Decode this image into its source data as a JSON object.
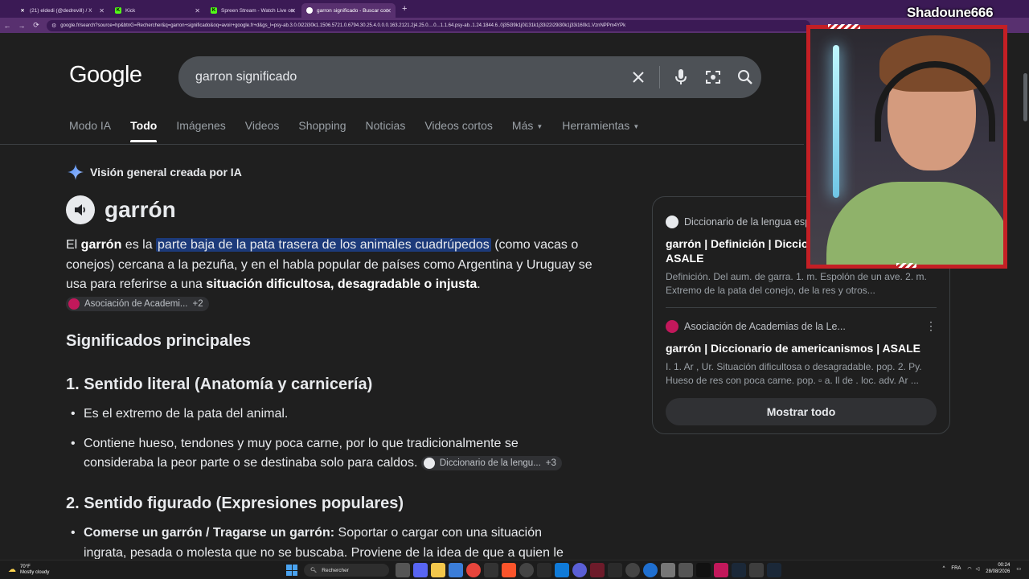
{
  "browser": {
    "tabs": [
      {
        "label": "(21) eldedi (@dedrevill) / X",
        "icon": "x-logo-icon",
        "active": false
      },
      {
        "label": "Kick",
        "icon": "kick-logo-icon",
        "active": false
      },
      {
        "label": "Spreen Stream - Watch Live on",
        "icon": "kick-logo-icon",
        "active": false
      },
      {
        "label": "garron significado - Buscar con",
        "icon": "google-logo-icon",
        "active": true
      }
    ],
    "new_tab": "+",
    "url": "google.fr/search?source=hp&btnG=Rechercher&q=garron+significado&oq=avoir+google.fr+d&gs_l=psy-ab.3.0.0i22i30k1.1506.5721.0.6794.30.25.4.0.0.0.163.2121.2j4.25.0....0...1.1.64.psy-ab..1.24.1844.6..0j35i39k1j0i131k1j33i22i29i30k1j33i160k1.VznNPPm4YPk"
  },
  "google": {
    "logo": "Google",
    "query": "garron significado",
    "tabs": [
      "Modo IA",
      "Todo",
      "Imágenes",
      "Videos",
      "Shopping",
      "Noticias",
      "Videos cortos",
      "Más",
      "Herramientas"
    ],
    "active_tab": "Todo",
    "ai_overview": {
      "header": "Visión general creada por IA",
      "term": "garrón",
      "para1": {
        "p1": "El ",
        "b1": "garrón",
        "p2": " es la ",
        "highlight": "parte baja de la pata trasera de los animales cuadrúpedos",
        "p3": " (como vacas o conejos) cercana a la pezuña, y en el habla popular de países como Argentina y Uruguay se usa para referirse a una ",
        "b2": "situación dificultosa, desagradable o injusta",
        "p4": ".",
        "chip_label": "Asociación de Academi...",
        "chip_more": "+2"
      },
      "section_main": "Significados principales",
      "section1": {
        "title": "1. Sentido literal (Anatomía y carnicería)",
        "bullet1": "Es el extremo de la pata del animal.",
        "bullet2": "Contiene hueso, tendones y muy poca carne, por lo que tradicionalmente se consideraba la peor parte o se destinaba solo para caldos.",
        "chip_label": "Diccionario de la lengu...",
        "chip_more": "+3"
      },
      "section2": {
        "title": "2. Sentido figurado (Expresiones populares)",
        "bullet1_bold": "Comerse un garrón / Tragarse un garrón:",
        "bullet1_text": " Soportar o cargar con una situación ingrata, pesada o molesta que no se buscaba. Proviene de la idea de que a quien le"
      }
    },
    "sources": [
      {
        "site": "Diccionario de la lengua esp",
        "title": "garrón | Definición | Diccio española | RAE - ASALE",
        "desc": "Definición. Del aum. de garra. 1. m. Espolón de un ave. 2. m. Extremo de la pata del conejo, de la res y otros..."
      },
      {
        "site": "Asociación de Academias de la Le...",
        "title": "garrón | Diccionario de americanismos | ASALE",
        "desc": "I. 1. Ar , Ur. Situación dificultosa o desagradable. pop. 2. Py. Hueso de res con poca carne. pop. ▫ a. ll de . loc. adv. Ar ..."
      }
    ],
    "show_all": "Mostrar todo"
  },
  "overlay": {
    "streamer_name": "Shadoune666"
  },
  "taskbar": {
    "weather_temp": "70°F",
    "weather_desc": "Mostly cloudy",
    "search_placeholder": "Rechercher",
    "lang": "FRA",
    "time": "00:24",
    "date": "28/08/2026"
  },
  "colors": {
    "accent_purple": "#58306f",
    "highlight_blue": "#1c3a7a",
    "overlay_red": "#c41f25"
  }
}
